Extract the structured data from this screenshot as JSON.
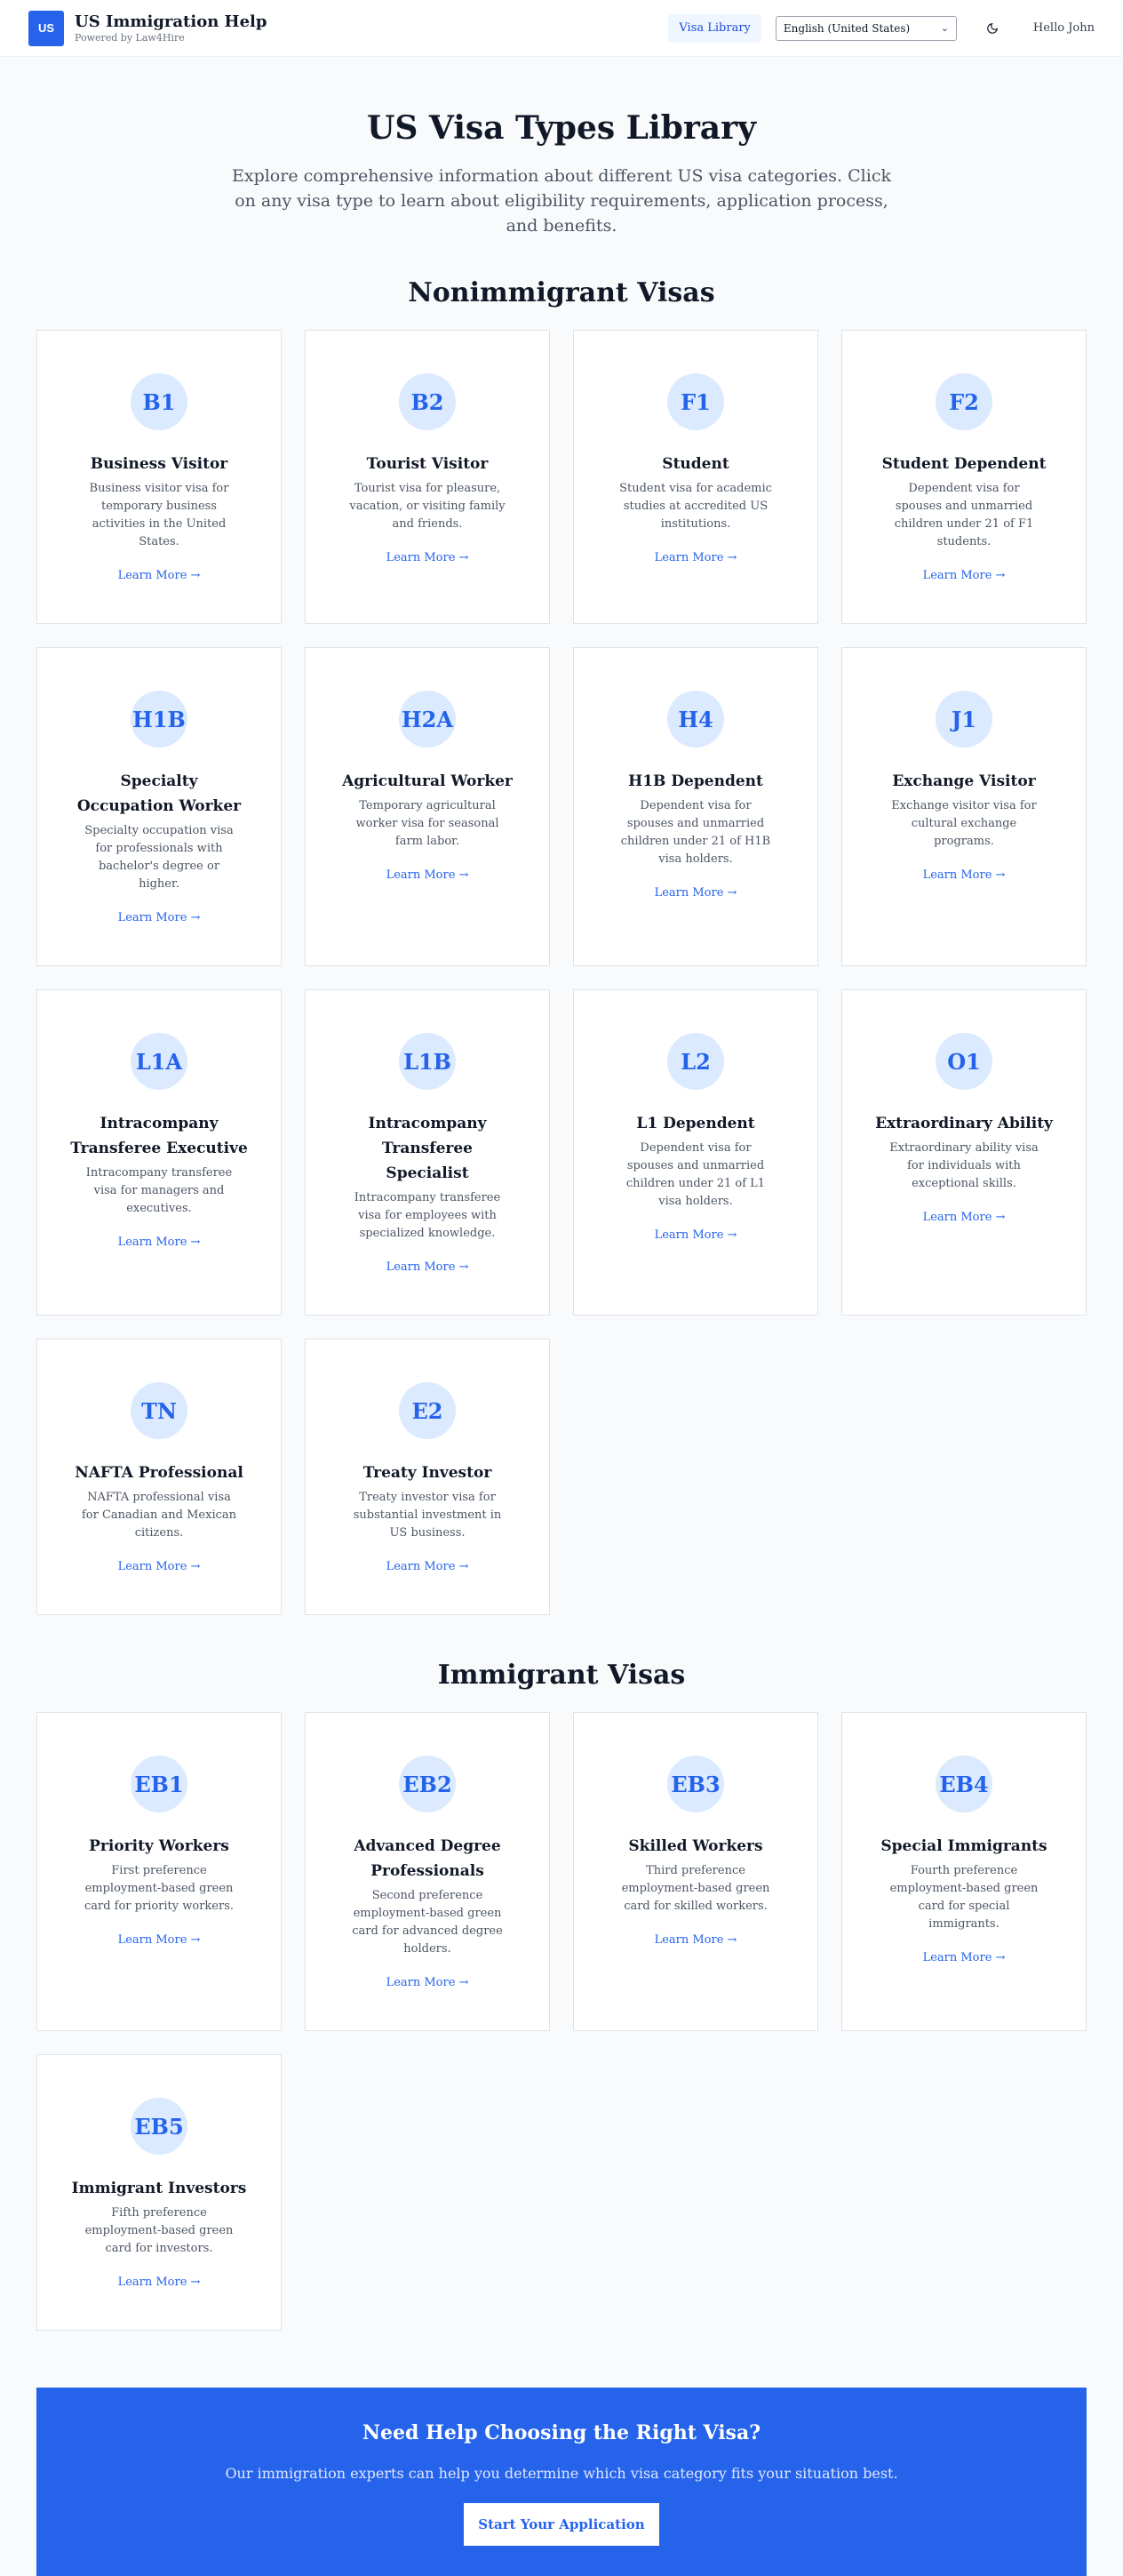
{
  "header": {
    "logo_text": "US",
    "title": "US Immigration Help",
    "subtitle": "Powered by Law4Hire",
    "nav_library": "Visa Library",
    "language": "English (United States)",
    "theme_icon": "moon-icon",
    "greeting": "Hello John"
  },
  "hero": {
    "title": "US Visa Types Library",
    "description": "Explore comprehensive information about different US visa categories. Click on any visa type to learn about eligibility requirements, application process, and benefits."
  },
  "nonimmigrant": {
    "title": "Nonimmigrant Visas",
    "cards": [
      {
        "code": "B1",
        "name": "Business Visitor",
        "desc": "Business visitor visa for temporary business activities in the United States.",
        "link": "Learn More →"
      },
      {
        "code": "B2",
        "name": "Tourist Visitor",
        "desc": "Tourist visa for pleasure, vacation, or visiting family and friends.",
        "link": "Learn More →"
      },
      {
        "code": "F1",
        "name": "Student",
        "desc": "Student visa for academic studies at accredited US institutions.",
        "link": "Learn More →"
      },
      {
        "code": "F2",
        "name": "Student Dependent",
        "desc": "Dependent visa for spouses and unmarried children under 21 of F1 students.",
        "link": "Learn More →"
      },
      {
        "code": "H1B",
        "name": "Specialty Occupation Worker",
        "desc": "Specialty occupation visa for professionals with bachelor's degree or higher.",
        "link": "Learn More →"
      },
      {
        "code": "H2A",
        "name": "Agricultural Worker",
        "desc": "Temporary agricultural worker visa for seasonal farm labor.",
        "link": "Learn More →"
      },
      {
        "code": "H4",
        "name": "H1B Dependent",
        "desc": "Dependent visa for spouses and unmarried children under 21 of H1B visa holders.",
        "link": "Learn More →"
      },
      {
        "code": "J1",
        "name": "Exchange Visitor",
        "desc": "Exchange visitor visa for cultural exchange programs.",
        "link": "Learn More →"
      },
      {
        "code": "L1A",
        "name": "Intracompany Transferee Executive",
        "desc": "Intracompany transferee visa for managers and executives.",
        "link": "Learn More →"
      },
      {
        "code": "L1B",
        "name": "Intracompany Transferee Specialist",
        "desc": "Intracompany transferee visa for employees with specialized knowledge.",
        "link": "Learn More →"
      },
      {
        "code": "L2",
        "name": "L1 Dependent",
        "desc": "Dependent visa for spouses and unmarried children under 21 of L1 visa holders.",
        "link": "Learn More →"
      },
      {
        "code": "O1",
        "name": "Extraordinary Ability",
        "desc": "Extraordinary ability visa for individuals with exceptional skills.",
        "link": "Learn More →"
      },
      {
        "code": "TN",
        "name": "NAFTA Professional",
        "desc": "NAFTA professional visa for Canadian and Mexican citizens.",
        "link": "Learn More →"
      },
      {
        "code": "E2",
        "name": "Treaty Investor",
        "desc": "Treaty investor visa for substantial investment in US business.",
        "link": "Learn More →"
      }
    ]
  },
  "immigrant": {
    "title": "Immigrant Visas",
    "cards": [
      {
        "code": "EB1",
        "name": "Priority Workers",
        "desc": "First preference employment-based green card for priority workers.",
        "link": "Learn More →"
      },
      {
        "code": "EB2",
        "name": "Advanced Degree Professionals",
        "desc": "Second preference employment-based green card for advanced degree holders.",
        "link": "Learn More →"
      },
      {
        "code": "EB3",
        "name": "Skilled Workers",
        "desc": "Third preference employment-based green card for skilled workers.",
        "link": "Learn More →"
      },
      {
        "code": "EB4",
        "name": "Special Immigrants",
        "desc": "Fourth preference employment-based green card for special immigrants.",
        "link": "Learn More →"
      },
      {
        "code": "EB5",
        "name": "Immigrant Investors",
        "desc": "Fifth preference employment-based green card for investors.",
        "link": "Learn More →"
      }
    ]
  },
  "cta": {
    "title": "Need Help Choosing the Right Visa?",
    "text": "Our immigration experts can help you determine which visa category fits your situation best.",
    "button": "Start Your Application"
  },
  "colors": {
    "brand": "#2563eb",
    "badge_bg": "#dbeafe"
  }
}
